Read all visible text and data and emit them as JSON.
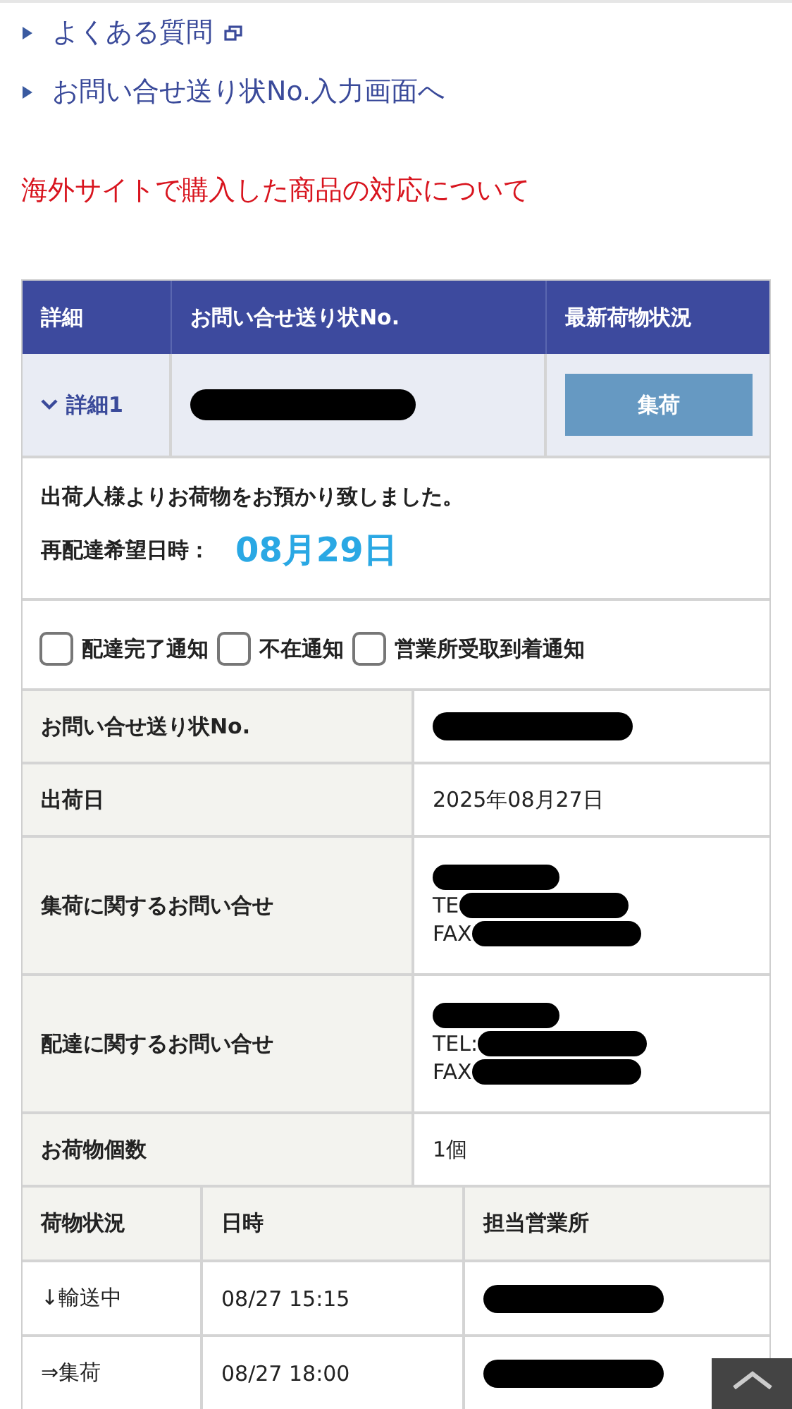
{
  "links": [
    {
      "label": "よくある質問",
      "external": true
    },
    {
      "label": "お問い合せ送り状No.入力画面へ",
      "external": false
    }
  ],
  "notice": "海外サイトで購入した商品の対応について",
  "summary": {
    "columns": [
      "詳細",
      "お問い合せ送り状No.",
      "最新荷物状況"
    ],
    "row": {
      "detail_label": "詳細1",
      "expanded": true,
      "status_button": "集荷"
    }
  },
  "message": "出荷人様よりお荷物をお預かり致しました。",
  "redelivery": {
    "label": "再配達希望日時：",
    "date": "08月29日"
  },
  "notifications": [
    {
      "label": "配達完了通知",
      "checked": false
    },
    {
      "label": "不在通知",
      "checked": false
    },
    {
      "label": "営業所受取到着通知",
      "checked": false
    }
  ],
  "info_rows": [
    {
      "label": "お問い合せ送り状No.",
      "kind": "redacted"
    },
    {
      "label": "出荷日",
      "kind": "text",
      "value": "2025年08月27日"
    },
    {
      "label": "集荷に関するお問い合せ",
      "kind": "contact",
      "lines": [
        "TE",
        "FAX"
      ]
    },
    {
      "label": "配達に関するお問い合せ",
      "kind": "contact",
      "lines": [
        "TEL:",
        "FAX"
      ]
    },
    {
      "label": "お荷物個数",
      "kind": "text",
      "value": "1個"
    }
  ],
  "history": {
    "columns": [
      "荷物状況",
      "日時",
      "担当営業所"
    ],
    "rows": [
      {
        "status": "↓輸送中",
        "time": "08/27 15:15"
      },
      {
        "status": "⇒集荷",
        "time": "08/27 18:00"
      }
    ]
  }
}
